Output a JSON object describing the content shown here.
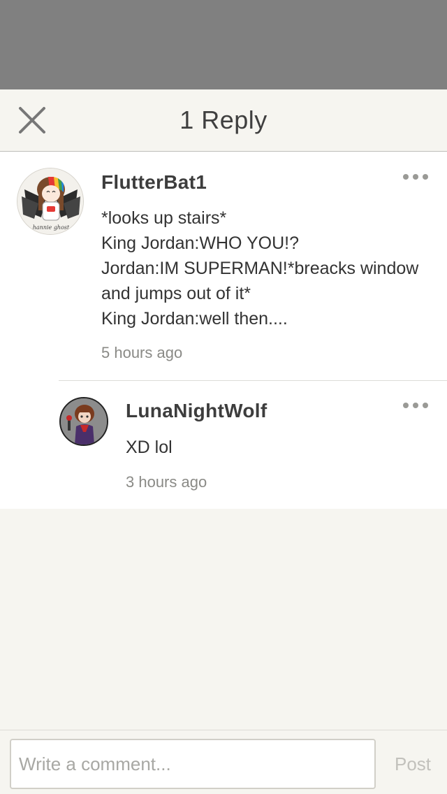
{
  "header": {
    "title": "1 Reply",
    "close_icon": "close-icon"
  },
  "comments": [
    {
      "author": "FlutterBat1",
      "lines": [
        "*looks up stairs*",
        "King Jordan:WHO YOU!?",
        "Jordan:IM SUPERMAN!*breacks window",
        "and jumps out of it*",
        "King Jordan:well then...."
      ],
      "timestamp": "5 hours ago",
      "avatar_caption": "hannie ghost"
    },
    {
      "author": "LunaNightWolf",
      "lines": [
        "XD lol"
      ],
      "timestamp": "3 hours ago"
    }
  ],
  "footer": {
    "placeholder": "Write a comment...",
    "value": "",
    "post_label": "Post"
  },
  "colors": {
    "overlay": "#808080",
    "background": "#f6f5f0",
    "text": "#3d3d3d",
    "muted": "#8a8a86",
    "post_disabled": "#c2c1bc"
  }
}
